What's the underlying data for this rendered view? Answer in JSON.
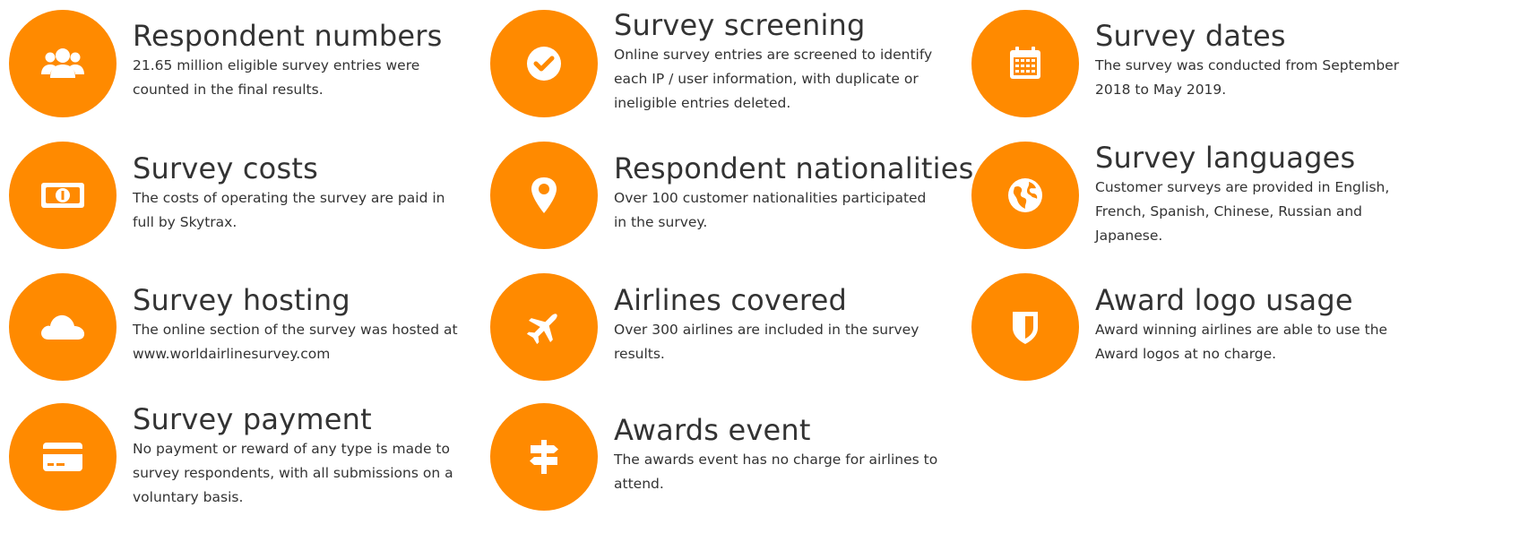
{
  "accent_color": "#FF8A00",
  "items": [
    {
      "icon": "users-icon",
      "title": "Respondent numbers",
      "desc": "21.65 million eligible survey entries were counted in the final results."
    },
    {
      "icon": "check-circle-icon",
      "title": "Survey screening",
      "desc": "Online survey entries are screened to identify each IP / user information, with duplicate or ineligible entries deleted."
    },
    {
      "icon": "calendar-icon",
      "title": "Survey dates",
      "desc": "The survey was conducted from September 2018 to May 2019."
    },
    {
      "icon": "money-bill-icon",
      "title": "Survey costs",
      "desc": "The costs of operating the survey are paid in full by Skytrax."
    },
    {
      "icon": "map-pin-icon",
      "title": "Respondent nationalities",
      "desc": "Over 100 customer nationalities participated in the survey."
    },
    {
      "icon": "globe-icon",
      "title": "Survey languages",
      "desc": "Customer surveys are provided in English, French, Spanish, Chinese, Russian and Japanese."
    },
    {
      "icon": "cloud-icon",
      "title": "Survey hosting",
      "desc": "The online section of the survey was hosted at www.worldairlinesurvey.com"
    },
    {
      "icon": "plane-icon",
      "title": "Airlines covered",
      "desc": "Over 300 airlines are included in the survey results."
    },
    {
      "icon": "shield-icon",
      "title": "Award logo usage",
      "desc": "Award winning airlines are able to use the Award logos at no charge."
    },
    {
      "icon": "credit-card-icon",
      "title": "Survey payment",
      "desc": "No payment or reward of any type is made to survey respondents, with all submissions on a voluntary basis."
    },
    {
      "icon": "signpost-icon",
      "title": "Awards event",
      "desc": "The awards event has no charge for airlines to attend."
    }
  ]
}
